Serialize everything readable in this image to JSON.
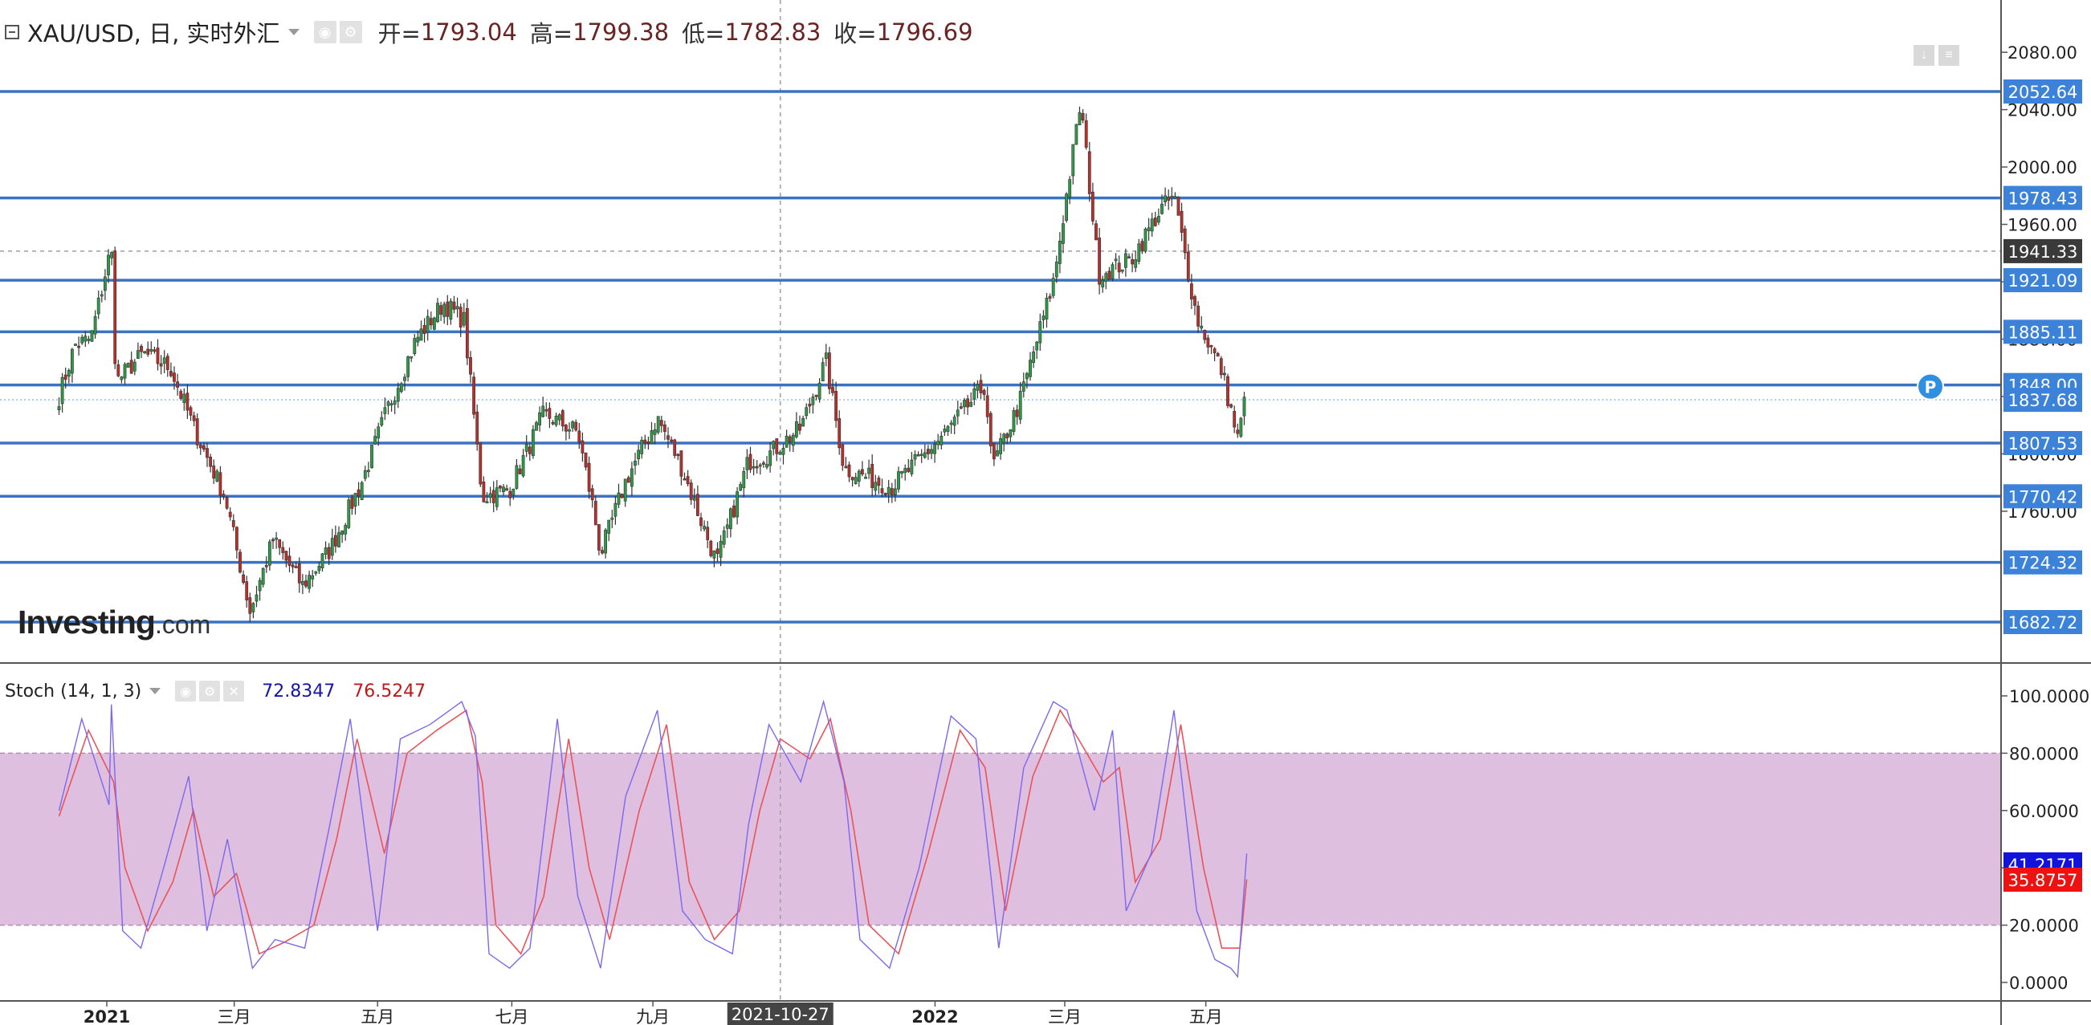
{
  "instrument": {
    "symbol": "XAU/USD",
    "interval": "日",
    "source": "实时外汇",
    "title": "XAU/USD, 日, 实时外汇"
  },
  "ohlc": {
    "open_label": "开=",
    "open": "1793.04",
    "high_label": "高=",
    "high": "1799.38",
    "low_label": "低=",
    "low": "1782.83",
    "close_label": "收=",
    "close": "1796.69"
  },
  "stoch_legend": {
    "name": "Stoch (14, 1, 3)",
    "k": "72.8347",
    "d": "76.5247"
  },
  "logo": {
    "brand": "Investing",
    "suffix": ".com"
  },
  "colors": {
    "up": "#2e9a47",
    "down": "#b7302b",
    "level_line": "#3a73c2",
    "level_badge": "#3d82d9",
    "k_line": "#7b68ee",
    "d_line": "#e8545a",
    "stoch_band": "#dfbfe0",
    "k_badge": "#1212dd",
    "d_badge": "#ee1111"
  },
  "icons": [
    "minus-box-icon",
    "dropdown-caret-icon",
    "eye-icon",
    "gear-icon",
    "close-icon",
    "download-icon",
    "menu-icon",
    "p-marker-icon"
  ],
  "chart_data": [
    {
      "type": "candlestick",
      "title": "XAU/USD, 日, 实时外汇",
      "x_ticks": [
        "2021",
        "三月",
        "五月",
        "七月",
        "九月",
        "2021-10-27",
        "2022",
        "三月",
        "五月"
      ],
      "y_ticks": [
        "1760.00",
        "1800.00",
        "1840.00",
        "1880.00",
        "1920.00",
        "1960.00",
        "2000.00",
        "2040.00",
        "2080.00"
      ],
      "ylim": [
        1668,
        2088
      ],
      "horizontal_levels": [
        "2052.64",
        "1978.43",
        "1921.09",
        "1885.11",
        "1848.00",
        "1807.53",
        "1770.42",
        "1724.32",
        "1682.72"
      ],
      "current_price": "1837.68",
      "crosshair_price": "1941.33",
      "crosshair_date": "2021-10-27",
      "price_path": [
        [
          "2020-12-14",
          1840
        ],
        [
          "2020-12-21",
          1876
        ],
        [
          "2020-12-28",
          1880
        ],
        [
          "2021-01-06",
          1945
        ],
        [
          "2021-01-08",
          1850
        ],
        [
          "2021-01-20",
          1870
        ],
        [
          "2021-02-01",
          1860
        ],
        [
          "2021-02-12",
          1815
        ],
        [
          "2021-02-25",
          1770
        ],
        [
          "2021-03-08",
          1690
        ],
        [
          "2021-03-18",
          1740
        ],
        [
          "2021-03-31",
          1708
        ],
        [
          "2021-04-12",
          1733
        ],
        [
          "2021-04-26",
          1780
        ],
        [
          "2021-05-07",
          1830
        ],
        [
          "2021-05-20",
          1880
        ],
        [
          "2021-06-01",
          1905
        ],
        [
          "2021-06-10",
          1893
        ],
        [
          "2021-06-18",
          1770
        ],
        [
          "2021-06-30",
          1775
        ],
        [
          "2021-07-15",
          1828
        ],
        [
          "2021-07-30",
          1815
        ],
        [
          "2021-08-06",
          1760
        ],
        [
          "2021-08-09",
          1730
        ],
        [
          "2021-08-20",
          1781
        ],
        [
          "2021-09-03",
          1825
        ],
        [
          "2021-09-13",
          1793
        ],
        [
          "2021-09-29",
          1724
        ],
        [
          "2021-10-13",
          1795
        ],
        [
          "2021-10-22",
          1800
        ],
        [
          "2021-11-05",
          1818
        ],
        [
          "2021-11-16",
          1865
        ],
        [
          "2021-11-24",
          1790
        ],
        [
          "2021-12-15",
          1777
        ],
        [
          "2022-01-05",
          1810
        ],
        [
          "2022-01-25",
          1848
        ],
        [
          "2022-01-28",
          1790
        ],
        [
          "2022-02-09",
          1835
        ],
        [
          "2022-02-24",
          1920
        ],
        [
          "2022-03-08",
          2045
        ],
        [
          "2022-03-16",
          1925
        ],
        [
          "2022-03-30",
          1935
        ],
        [
          "2022-04-12",
          1970
        ],
        [
          "2022-04-18",
          1980
        ],
        [
          "2022-04-28",
          1895
        ],
        [
          "2022-05-09",
          1858
        ],
        [
          "2022-05-16",
          1810
        ],
        [
          "2022-05-20",
          1845
        ]
      ]
    },
    {
      "type": "line",
      "title": "Stoch (14, 1, 3)",
      "y_ticks": [
        "0.0000",
        "20.0000",
        "40.0000",
        "60.0000",
        "80.0000",
        "100.0000"
      ],
      "ylim": [
        -4,
        104
      ],
      "band": [
        20,
        80
      ],
      "last_values": {
        "k": "41.2171",
        "d": "35.8757"
      },
      "k_path": [
        [
          "2020-12-14",
          60
        ],
        [
          "2020-12-24",
          92
        ],
        [
          "2021-01-05",
          62
        ],
        [
          "2021-01-06",
          97
        ],
        [
          "2021-01-11",
          18
        ],
        [
          "2021-01-19",
          12
        ],
        [
          "2021-01-29",
          40
        ],
        [
          "2021-02-09",
          72
        ],
        [
          "2021-02-17",
          18
        ],
        [
          "2021-02-26",
          50
        ],
        [
          "2021-03-09",
          5
        ],
        [
          "2021-03-19",
          15
        ],
        [
          "2021-04-01",
          12
        ],
        [
          "2021-04-12",
          55
        ],
        [
          "2021-04-21",
          92
        ],
        [
          "2021-05-03",
          18
        ],
        [
          "2021-05-13",
          85
        ],
        [
          "2021-05-26",
          90
        ],
        [
          "2021-06-09",
          98
        ],
        [
          "2021-06-15",
          86
        ],
        [
          "2021-06-21",
          10
        ],
        [
          "2021-06-30",
          5
        ],
        [
          "2021-07-09",
          12
        ],
        [
          "2021-07-21",
          92
        ],
        [
          "2021-07-30",
          30
        ],
        [
          "2021-08-09",
          5
        ],
        [
          "2021-08-20",
          65
        ],
        [
          "2021-09-03",
          95
        ],
        [
          "2021-09-14",
          25
        ],
        [
          "2021-09-24",
          15
        ],
        [
          "2021-10-06",
          10
        ],
        [
          "2021-10-13",
          55
        ],
        [
          "2021-10-22",
          90
        ],
        [
          "2021-11-05",
          70
        ],
        [
          "2021-11-15",
          98
        ],
        [
          "2021-11-24",
          70
        ],
        [
          "2021-12-01",
          15
        ],
        [
          "2021-12-14",
          5
        ],
        [
          "2021-12-27",
          40
        ],
        [
          "2022-01-10",
          93
        ],
        [
          "2022-01-21",
          85
        ],
        [
          "2022-01-31",
          12
        ],
        [
          "2022-02-11",
          75
        ],
        [
          "2022-02-24",
          98
        ],
        [
          "2022-03-02",
          95
        ],
        [
          "2022-03-14",
          60
        ],
        [
          "2022-03-22",
          88
        ],
        [
          "2022-03-28",
          25
        ],
        [
          "2022-04-08",
          45
        ],
        [
          "2022-04-18",
          95
        ],
        [
          "2022-04-28",
          25
        ],
        [
          "2022-05-06",
          8
        ],
        [
          "2022-05-13",
          5
        ],
        [
          "2022-05-16",
          2
        ],
        [
          "2022-05-20",
          45
        ]
      ],
      "d_path": [
        [
          "2020-12-14",
          58
        ],
        [
          "2020-12-27",
          88
        ],
        [
          "2021-01-07",
          70
        ],
        [
          "2021-01-12",
          40
        ],
        [
          "2021-01-22",
          18
        ],
        [
          "2021-02-02",
          35
        ],
        [
          "2021-02-11",
          60
        ],
        [
          "2021-02-20",
          30
        ],
        [
          "2021-03-02",
          38
        ],
        [
          "2021-03-12",
          10
        ],
        [
          "2021-03-23",
          14
        ],
        [
          "2021-04-05",
          20
        ],
        [
          "2021-04-15",
          50
        ],
        [
          "2021-04-24",
          85
        ],
        [
          "2021-05-06",
          45
        ],
        [
          "2021-05-16",
          80
        ],
        [
          "2021-05-29",
          88
        ],
        [
          "2021-06-11",
          95
        ],
        [
          "2021-06-18",
          70
        ],
        [
          "2021-06-24",
          20
        ],
        [
          "2021-07-05",
          10
        ],
        [
          "2021-07-15",
          30
        ],
        [
          "2021-07-26",
          85
        ],
        [
          "2021-08-04",
          40
        ],
        [
          "2021-08-13",
          15
        ],
        [
          "2021-08-26",
          60
        ],
        [
          "2021-09-07",
          90
        ],
        [
          "2021-09-17",
          35
        ],
        [
          "2021-09-28",
          15
        ],
        [
          "2021-10-09",
          25
        ],
        [
          "2021-10-18",
          60
        ],
        [
          "2021-10-27",
          85
        ],
        [
          "2021-11-09",
          78
        ],
        [
          "2021-11-18",
          92
        ],
        [
          "2021-11-27",
          60
        ],
        [
          "2021-12-05",
          20
        ],
        [
          "2021-12-18",
          10
        ],
        [
          "2021-12-31",
          45
        ],
        [
          "2022-01-14",
          88
        ],
        [
          "2022-01-25",
          75
        ],
        [
          "2022-02-03",
          25
        ],
        [
          "2022-02-15",
          72
        ],
        [
          "2022-02-27",
          95
        ],
        [
          "2022-03-07",
          85
        ],
        [
          "2022-03-18",
          70
        ],
        [
          "2022-03-25",
          75
        ],
        [
          "2022-04-01",
          35
        ],
        [
          "2022-04-12",
          50
        ],
        [
          "2022-04-21",
          90
        ],
        [
          "2022-05-01",
          40
        ],
        [
          "2022-05-09",
          12
        ],
        [
          "2022-05-17",
          12
        ],
        [
          "2022-05-20",
          36
        ]
      ]
    }
  ]
}
